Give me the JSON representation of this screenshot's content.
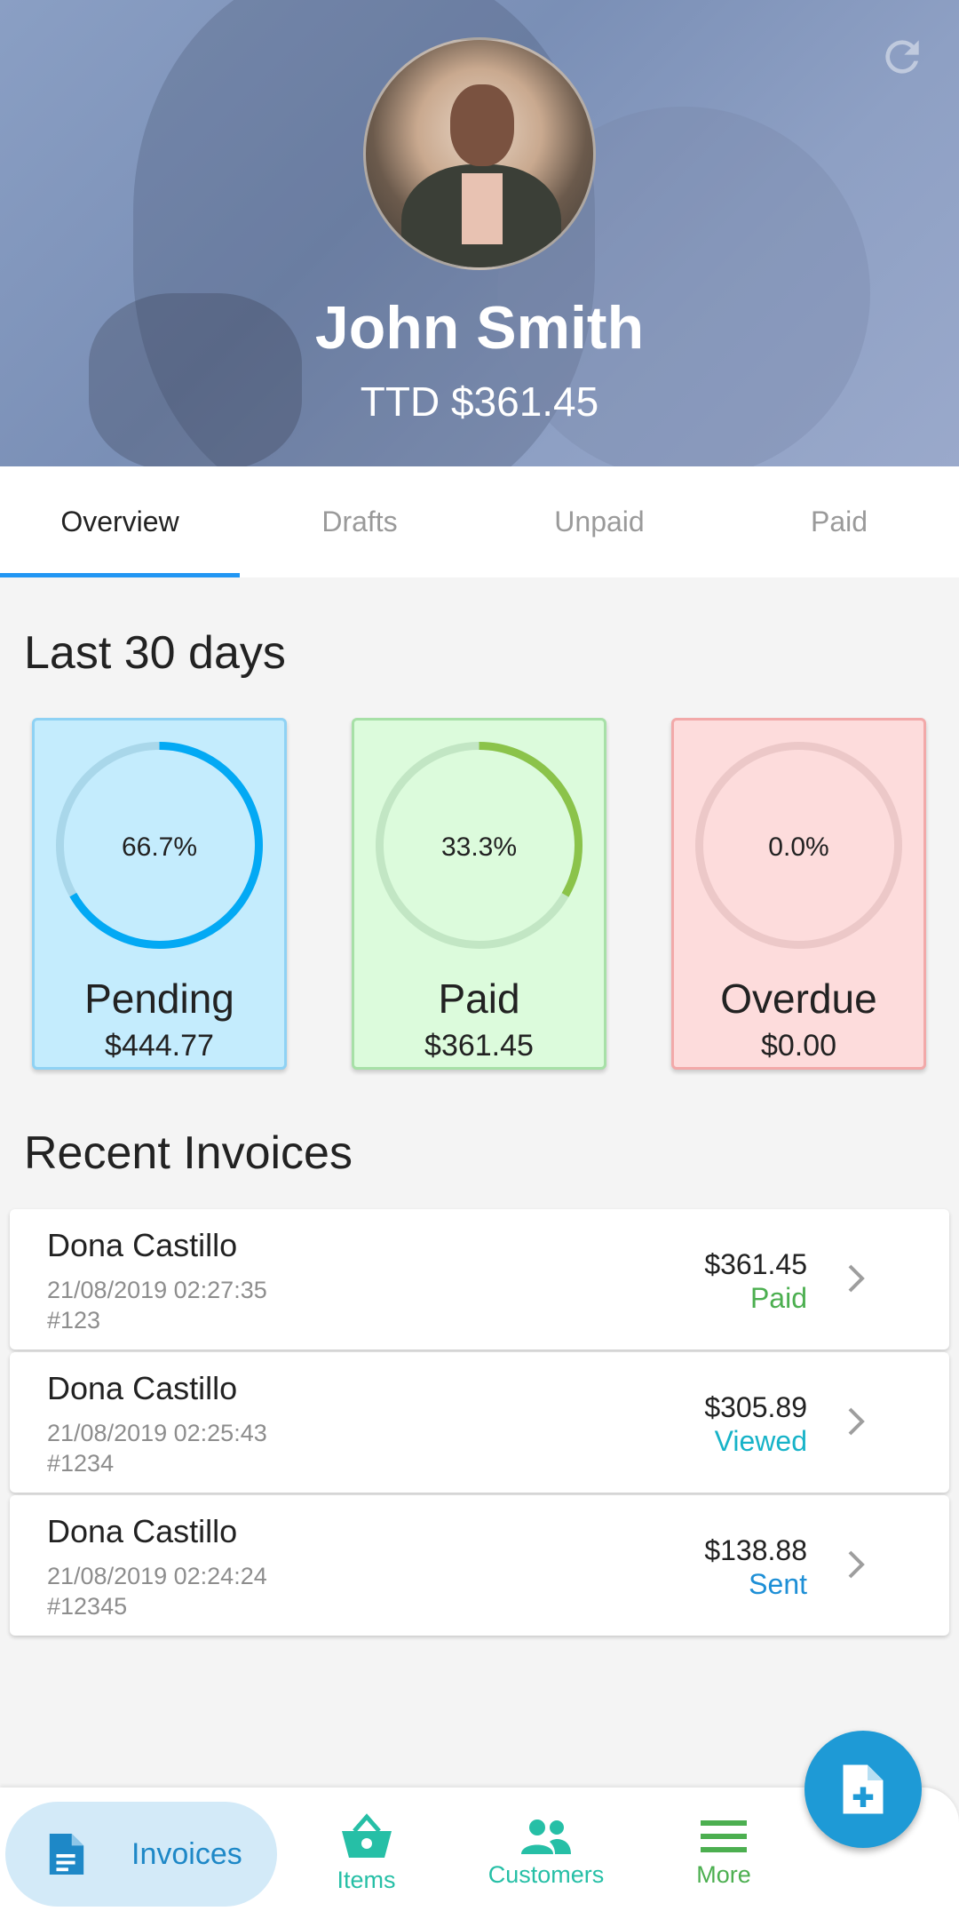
{
  "profile": {
    "name": "John Smith",
    "balance": "TTD $361.45"
  },
  "tabs": [
    {
      "label": "Overview",
      "active": true
    },
    {
      "label": "Drafts",
      "active": false
    },
    {
      "label": "Unpaid",
      "active": false
    },
    {
      "label": "Paid",
      "active": false
    }
  ],
  "summary": {
    "title": "Last 30 days",
    "cards": [
      {
        "label": "Pending",
        "percent": "66.7%",
        "progress": 0.667,
        "amount": "$444.77",
        "bg": "#c4ecfd",
        "border": "#8fd2f4",
        "track": "#a9d7ea",
        "arc": "#03a9f4"
      },
      {
        "label": "Paid",
        "percent": "33.3%",
        "progress": 0.333,
        "amount": "$361.45",
        "bg": "#dcfbdc",
        "border": "#a7e0a7",
        "track": "#c2e6c4",
        "arc": "#8bc34a"
      },
      {
        "label": "Overdue",
        "percent": "0.0%",
        "progress": 0.0,
        "amount": "$0.00",
        "bg": "#fddcdc",
        "border": "#f2a9a9",
        "track": "#ecc8c8",
        "arc": "#f44336"
      }
    ]
  },
  "recent": {
    "title": "Recent Invoices",
    "invoices": [
      {
        "customer": "Dona Castillo",
        "date": "21/08/2019 02:27:35",
        "number": "#123",
        "amount": "$361.45",
        "status": "Paid",
        "status_color": "#4caf50"
      },
      {
        "customer": "Dona Castillo",
        "date": "21/08/2019 02:25:43",
        "number": "#1234",
        "amount": "$305.89",
        "status": "Viewed",
        "status_color": "#17b3c8"
      },
      {
        "customer": "Dona Castillo",
        "date": "21/08/2019 02:24:24",
        "number": "#12345",
        "amount": "$138.88",
        "status": "Sent",
        "status_color": "#1e8fd6"
      }
    ]
  },
  "nav": {
    "invoices": "Invoices",
    "items": "Items",
    "customers": "Customers",
    "more": "More",
    "accent": "#1e88c7",
    "teal": "#26bfa6",
    "green": "#4caf50"
  },
  "icons": {
    "refresh": "refresh-icon",
    "fab": "new-invoice-icon"
  }
}
